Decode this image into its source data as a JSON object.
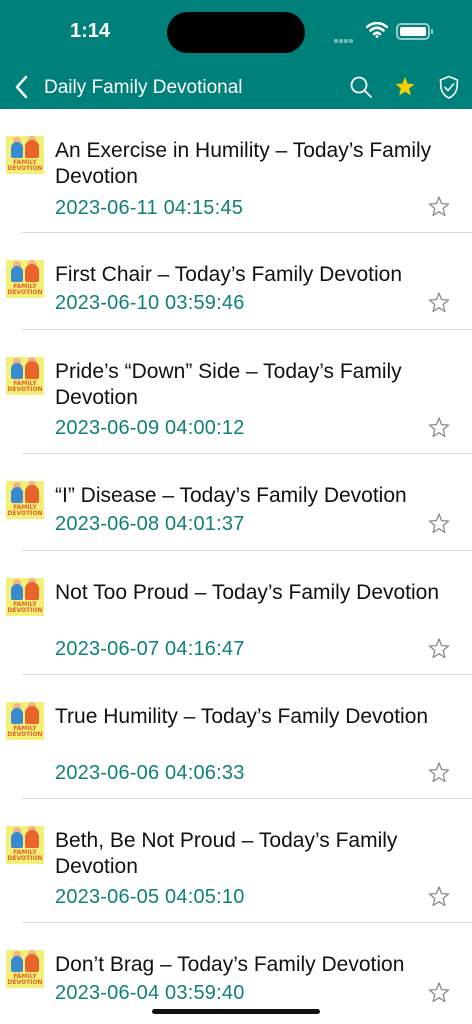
{
  "status_bar": {
    "time": "1:14"
  },
  "nav": {
    "title": "Daily Family Devotional",
    "favorite_star_color": "#f5d000"
  },
  "colors": {
    "header": "#00807a",
    "date": "#0f807a"
  },
  "thumbnail_text": "FAMILY\nDEVOTION",
  "items": [
    {
      "title": "An Exercise in Humility – Today’s Family Devotion",
      "date": "2023-06-11 04:15:45"
    },
    {
      "title": "First Chair – Today’s Family Devotion",
      "date": "2023-06-10 03:59:46"
    },
    {
      "title": "Pride’s “Down” Side – Today’s Family Devotion",
      "date": "2023-06-09 04:00:12"
    },
    {
      "title": "“I” Disease – Today’s Family Devotion",
      "date": "2023-06-08 04:01:37"
    },
    {
      "title": "Not Too Proud – Today’s Family Devotion",
      "date": "2023-06-07 04:16:47"
    },
    {
      "title": "True Humility – Today’s Family Devotion",
      "date": "2023-06-06 04:06:33"
    },
    {
      "title": "Beth, Be Not Proud – Today’s Family Devotion",
      "date": "2023-06-05 04:05:10"
    },
    {
      "title": "Don’t Brag – Today’s Family Devotion",
      "date": "2023-06-04 03:59:40"
    }
  ]
}
